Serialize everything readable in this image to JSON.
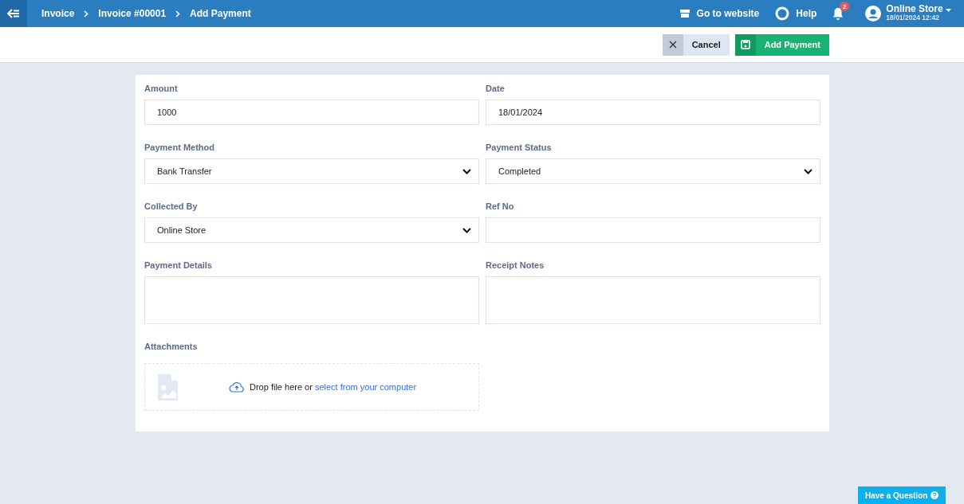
{
  "breadcrumb": [
    "Invoice",
    "Invoice #00001",
    "Add Payment"
  ],
  "header": {
    "website_link": "Go to website",
    "help": "Help",
    "notifications_count": "2",
    "user_name": "Online Store",
    "user_datetime": "18/01/2024 12:42"
  },
  "toolbar": {
    "cancel": "Cancel",
    "submit": "Add Payment"
  },
  "fields": [
    {
      "label": "Amount",
      "kind": "input",
      "value": "1000"
    },
    {
      "label": "Date",
      "kind": "input",
      "value": "18/01/2024"
    },
    {
      "label": "Payment Method",
      "kind": "select",
      "value": "Bank Transfer"
    },
    {
      "label": "Payment Status",
      "kind": "select",
      "value": "Completed"
    },
    {
      "label": "Collected By",
      "kind": "select",
      "value": "Online Store"
    },
    {
      "label": "Ref No",
      "kind": "input"
    },
    {
      "label": "Payment Details",
      "kind": "textarea"
    },
    {
      "label": "Receipt Notes",
      "kind": "textarea"
    }
  ],
  "attachments": {
    "label": "Attachments",
    "drop_text": "Drop file here or",
    "link": "select from your computer"
  },
  "help_button": "Have a Question"
}
